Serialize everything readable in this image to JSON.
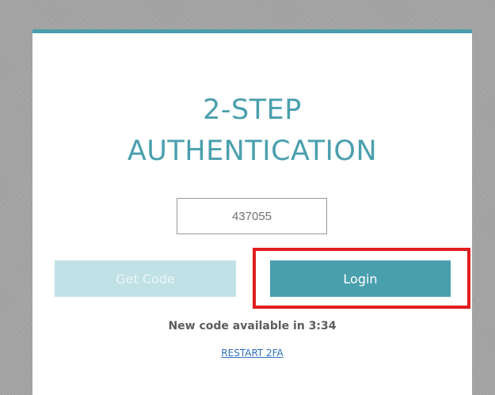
{
  "auth": {
    "title_line1": "2-STEP",
    "title_line2": "AUTHENTICATION",
    "code_value": "437055",
    "get_code_label": "Get Code",
    "login_label": "Login",
    "countdown_text": "New code available in 3:34",
    "restart_label": "RESTART 2FA"
  },
  "colors": {
    "accent": "#4a9fad",
    "disabled_button": "#c0e1e6",
    "highlight": "#e01e1e",
    "link": "#2f6fc0",
    "background": "#a4a4a4"
  }
}
